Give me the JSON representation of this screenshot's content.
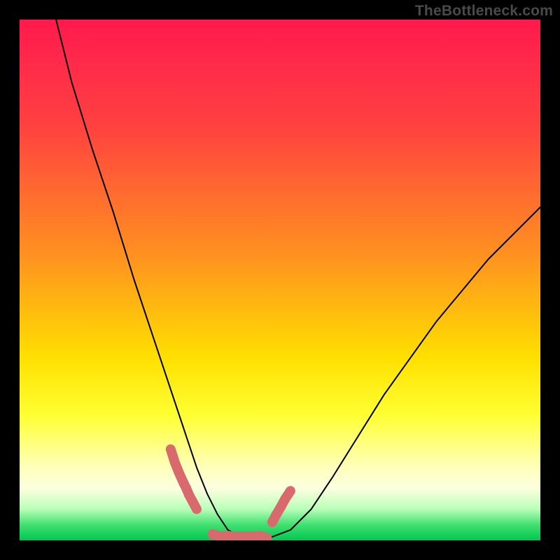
{
  "credit": "TheBottleneck.com",
  "colors": {
    "frame": "#000000",
    "curve": "#000000",
    "segment": "#d86a6e",
    "gradient_top": "#ff1a4d",
    "gradient_bottom": "#00c853"
  },
  "chart_data": {
    "type": "line",
    "title": "",
    "xlabel": "",
    "ylabel": "",
    "xlim": [
      0,
      100
    ],
    "ylim": [
      0,
      100
    ],
    "grid": false,
    "legend": false,
    "series": [
      {
        "name": "bottleneck-curve",
        "x": [
          7,
          10,
          14,
          18,
          22,
          26,
          28,
          30,
          32,
          34,
          36,
          38,
          40,
          42,
          45,
          48,
          52,
          56,
          60,
          65,
          70,
          75,
          80,
          85,
          90,
          95,
          100
        ],
        "y": [
          100,
          88,
          75,
          63,
          50,
          38,
          32,
          26,
          20,
          14,
          9,
          5,
          2,
          1,
          0,
          0.5,
          2,
          6,
          12,
          20,
          28,
          35,
          42,
          48,
          54,
          59,
          64
        ]
      }
    ],
    "highlight_segments": [
      {
        "name": "left-ticks",
        "x": [
          29.0,
          29.8,
          30.6,
          31.5,
          32.0,
          32.5,
          33.2,
          34.0
        ],
        "y": [
          17.5,
          15.0,
          13.0,
          11.0,
          10.0,
          8.8,
          7.5,
          6.0
        ]
      },
      {
        "name": "bottom-ticks",
        "x": [
          37.0,
          38.5,
          40.0,
          41.5,
          43.0,
          44.5,
          46.0,
          47.5
        ],
        "y": [
          1.2,
          0.8,
          0.9,
          0.8,
          0.8,
          0.8,
          0.9,
          0.5
        ]
      },
      {
        "name": "right-ticks",
        "x": [
          48.5,
          49.3,
          50.2,
          51.0,
          52.0
        ],
        "y": [
          3.5,
          5.0,
          6.5,
          8.0,
          9.5
        ]
      }
    ]
  }
}
